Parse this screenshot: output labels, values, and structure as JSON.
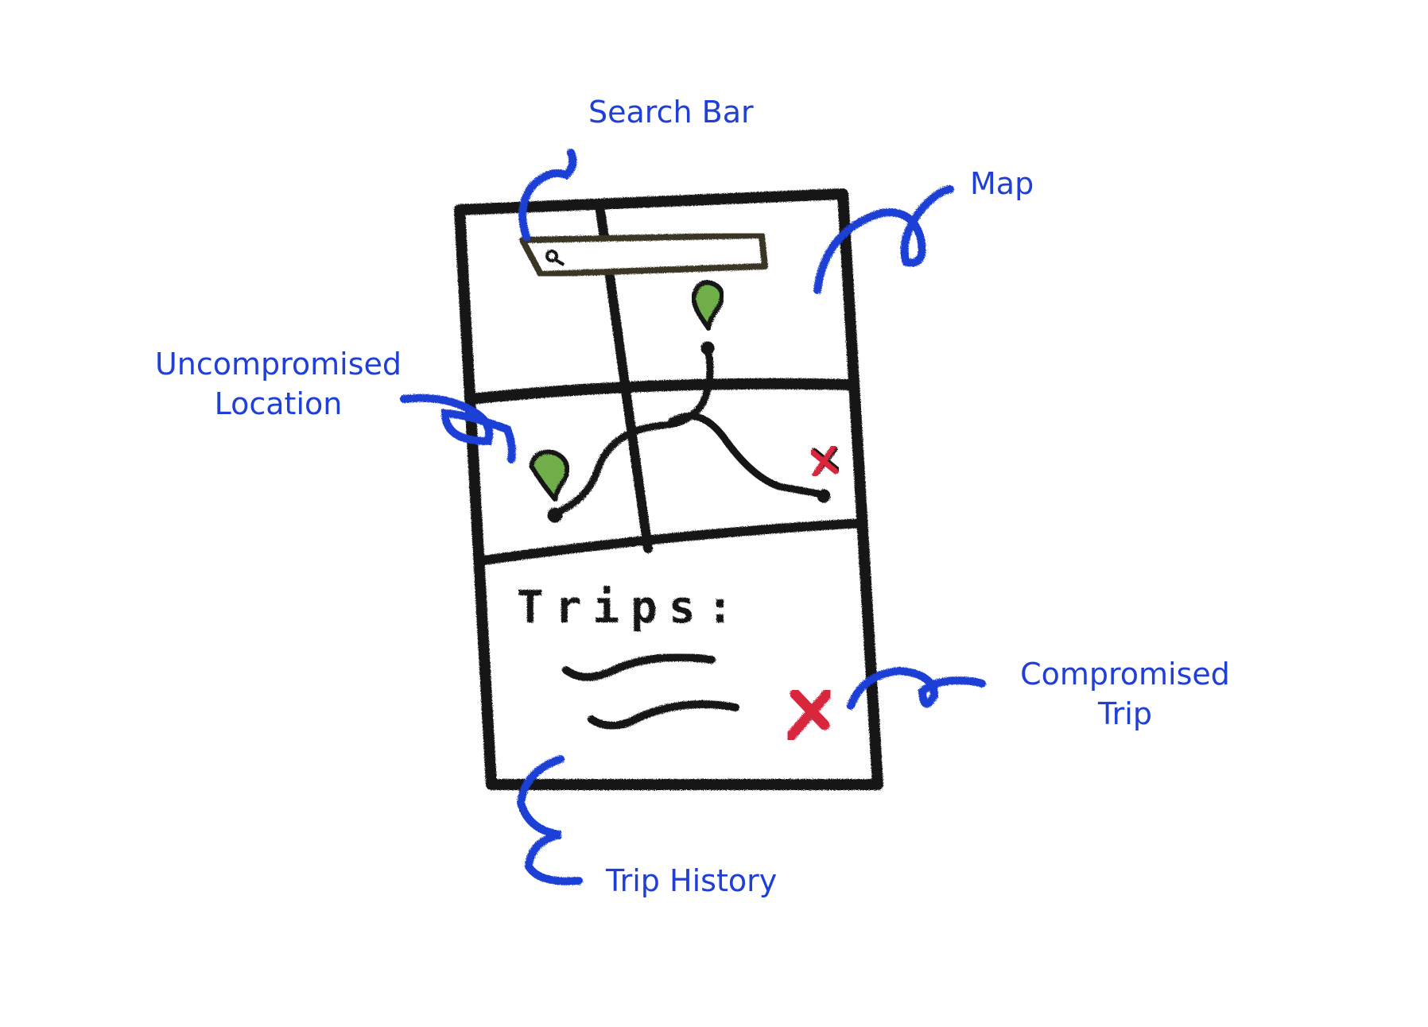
{
  "annotations": {
    "search_bar": "Search Bar",
    "map": "Map",
    "uncompromised_location_line1": "Uncompromised",
    "uncompromised_location_line2": "Location",
    "compromised_trip_line1": "Compromised",
    "compromised_trip_line2": "Trip",
    "trip_history": "Trip History"
  },
  "sketch": {
    "trips_heading": "Trips:"
  },
  "colors": {
    "annotation_blue": "#1f3fd6",
    "ink": "#141414",
    "pin_green": "#6fae4a",
    "compromised_red": "#d8263e"
  },
  "icons": {
    "search": "search-icon",
    "location_pin": "location-pin-icon",
    "compromised_marker": "x-mark-icon"
  }
}
